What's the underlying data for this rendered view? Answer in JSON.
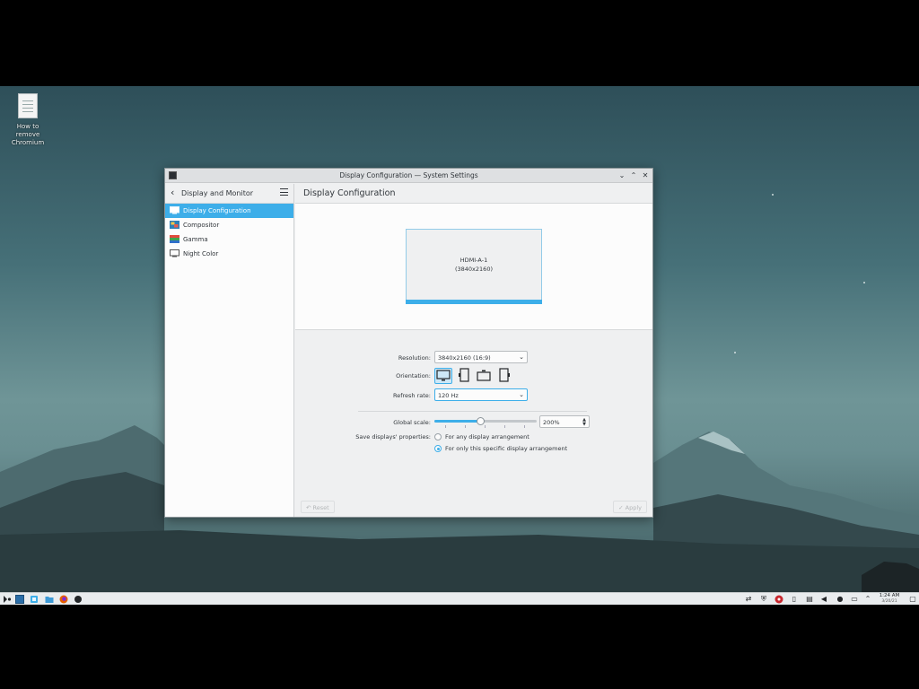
{
  "desktop": {
    "icon_label": "How to remove Chromium"
  },
  "window": {
    "title": "Display Configuration — System Settings",
    "controls": {
      "minimize": "⌄",
      "maximize": "⌃",
      "close": "✕"
    }
  },
  "sidebar": {
    "back_icon": "‹",
    "title": "Display and Monitor",
    "items": [
      {
        "label": "Display Configuration",
        "icon": "monitor-icon",
        "active": true
      },
      {
        "label": "Compositor",
        "icon": "compositor-icon",
        "active": false
      },
      {
        "label": "Gamma",
        "icon": "gamma-icon",
        "active": false
      },
      {
        "label": "Night Color",
        "icon": "night-color-icon",
        "active": false
      }
    ]
  },
  "content": {
    "title": "Display Configuration",
    "monitor": {
      "name": "HDMI-A-1",
      "resolution": "(3840x2160)"
    },
    "form": {
      "resolution_label": "Resolution:",
      "resolution_value": "3840x2160 (16:9)",
      "orientation_label": "Orientation:",
      "refresh_label": "Refresh rate:",
      "refresh_value": "120 Hz",
      "scale_label": "Global scale:",
      "scale_value": "200%",
      "scale_fraction": 0.45,
      "save_label": "Save displays' properties:",
      "radio_any": "For any display arrangement",
      "radio_specific": "For only this specific display arrangement",
      "selected_radio": "specific"
    },
    "buttons": {
      "reset": "Reset",
      "apply": "Apply"
    }
  },
  "taskbar": {
    "time": "1:24 AM",
    "date": "3/20/21"
  },
  "colors": {
    "accent": "#3daee9",
    "window_bg": "#eff0f1",
    "taskbar_bg": "#e9ecee"
  }
}
